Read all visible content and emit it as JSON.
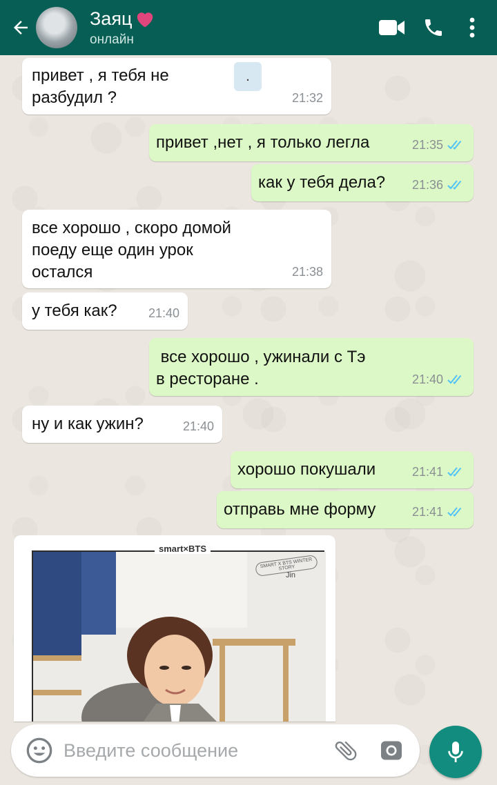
{
  "header": {
    "contact_name": "Заяц",
    "status": "онлайн",
    "accent_color": "#075e54",
    "heart_color": "#e0457b"
  },
  "messages": [
    {
      "dir": "in",
      "lines": [
        "привет , я тебя не",
        "разбудил ?"
      ],
      "time": "21:32",
      "attachment_text": "."
    },
    {
      "dir": "out",
      "lines": [
        "привет ,нет , я только легла"
      ],
      "time": "21:35",
      "read": true
    },
    {
      "dir": "out",
      "lines": [
        "как у тебя дела?"
      ],
      "time": "21:36",
      "read": true
    },
    {
      "dir": "in",
      "lines": [
        "все хорошо , скоро домой",
        "поеду еще один урок",
        "остался"
      ],
      "time": "21:38"
    },
    {
      "dir": "in",
      "lines": [
        "у тебя как?"
      ],
      "time": "21:40"
    },
    {
      "dir": "out",
      "lines": [
        " все хорошо , ужинали с Тэ",
        "в ресторане ."
      ],
      "time": "21:40",
      "read": true
    },
    {
      "dir": "in",
      "lines": [
        "ну и как ужин?"
      ],
      "time": "21:40"
    },
    {
      "dir": "out",
      "lines": [
        "хорошо покушали"
      ],
      "time": "21:41",
      "read": true
    },
    {
      "dir": "out",
      "lines": [
        "отправь мне форму"
      ],
      "time": "21:41",
      "read": true
    }
  ],
  "media": {
    "brand": "smart×BTS",
    "badge": "SMART X BTS WINTER STORY",
    "member": "Jin"
  },
  "composer": {
    "placeholder": "Введите сообщение"
  },
  "icons": {
    "back": "back-arrow-icon",
    "video": "video-call-icon",
    "call": "phone-icon",
    "menu": "more-vert-icon",
    "emoji": "emoji-icon",
    "attach": "paperclip-icon",
    "camera": "camera-icon",
    "mic": "microphone-icon"
  },
  "read_tick_color": "#4fc3f7"
}
